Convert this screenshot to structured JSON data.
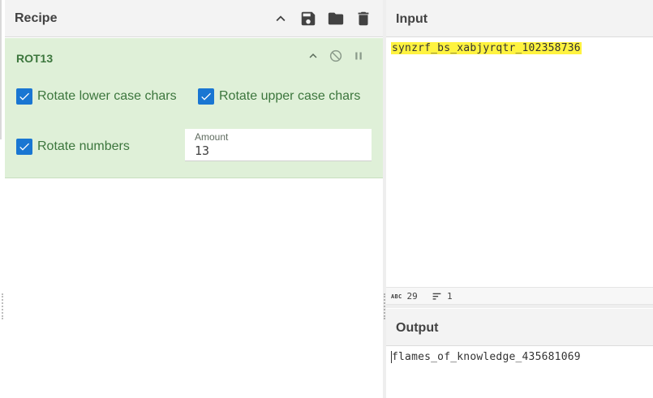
{
  "recipe": {
    "title": "Recipe",
    "header_icons": [
      "chevron-up-icon",
      "save-icon",
      "folder-icon",
      "trash-icon"
    ]
  },
  "operation": {
    "name": "ROT13",
    "icons": [
      "chevron-up-icon",
      "disable-icon",
      "pause-icon"
    ],
    "options": {
      "rotate_lower": "Rotate lower case chars",
      "rotate_upper": "Rotate upper case chars",
      "rotate_numbers": "Rotate numbers"
    },
    "amount": {
      "label": "Amount",
      "value": "13"
    },
    "colors": {
      "background": "#dff0d8",
      "text": "#3c763d",
      "checkbox": "#1976d2"
    }
  },
  "input": {
    "title": "Input",
    "text": "synzrf_bs_xabjyrqtr_102358736",
    "highlight_color": "#fff340",
    "stats": {
      "length": "29",
      "lines": "1",
      "length_icon_label": "ABC"
    }
  },
  "output": {
    "title": "Output",
    "text": "flames_of_knowledge_435681069"
  }
}
